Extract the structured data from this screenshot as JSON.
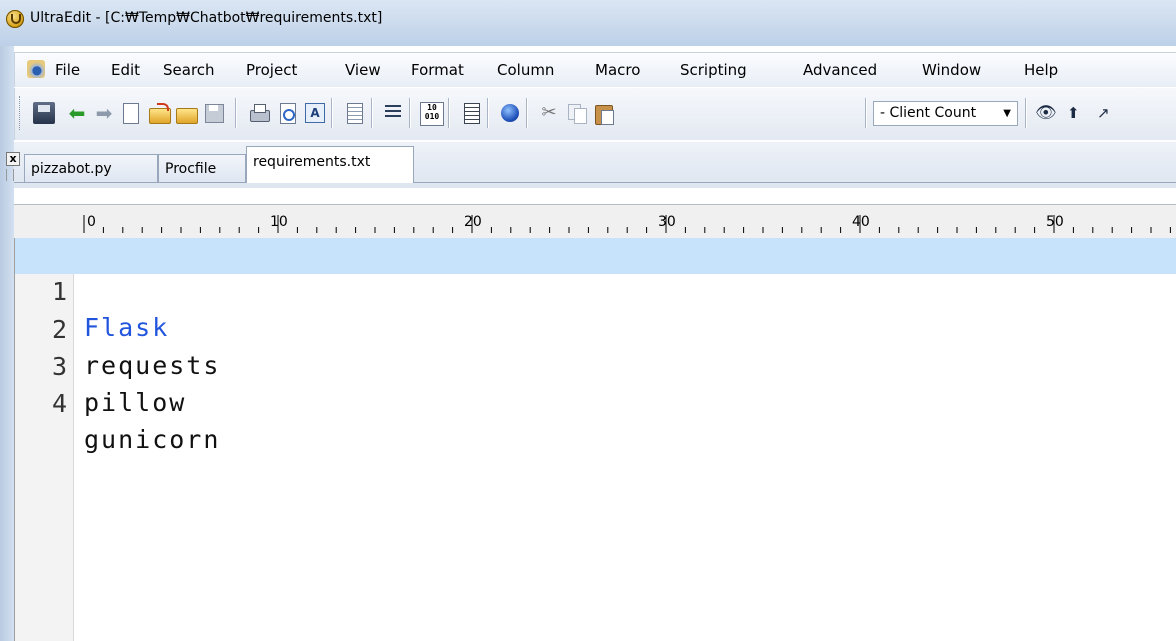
{
  "window": {
    "title": "UltraEdit - [C:₩Temp₩Chatbot₩requirements.txt]"
  },
  "menu": {
    "items": [
      "File",
      "Edit",
      "Search",
      "Project",
      "View",
      "Format",
      "Column",
      "Macro",
      "Scripting",
      "Advanced",
      "Window",
      "Help"
    ]
  },
  "toolbar": {
    "hex_label": "10\n010",
    "client_count": {
      "selected": "- Client Count",
      "arrow": "▼"
    },
    "icons": [
      "save-all-icon",
      "arrow-left-icon",
      "arrow-right-icon",
      "new-file-icon",
      "open-folder-icon",
      "folder-icon",
      "floppy-icon",
      "print-icon",
      "print-preview-icon",
      "font-icon",
      "page-icon",
      "word-wrap-icon",
      "hex-icon",
      "column-icon",
      "web-icon",
      "cut-icon",
      "copy-icon",
      "paste-icon",
      "find-icon",
      "find-prev-icon",
      "find-next-icon"
    ]
  },
  "tabs": {
    "close": "x",
    "items": [
      {
        "label": "pizzabot.py",
        "active": false
      },
      {
        "label": "Procfile",
        "active": false
      },
      {
        "label": "requirements.txt",
        "active": true
      }
    ]
  },
  "ruler": {
    "labels": [
      "0",
      "10",
      "20",
      "30",
      "40",
      "50"
    ]
  },
  "editor": {
    "current_line": 1,
    "lines": [
      {
        "number": "1",
        "text": "Flask"
      },
      {
        "number": "2",
        "text": "requests"
      },
      {
        "number": "3",
        "text": "pillow"
      },
      {
        "number": "4",
        "text": "gunicorn"
      }
    ]
  },
  "colors": {
    "current_line_bg": "#c6e3fb",
    "current_line_text": "#2255dd"
  }
}
